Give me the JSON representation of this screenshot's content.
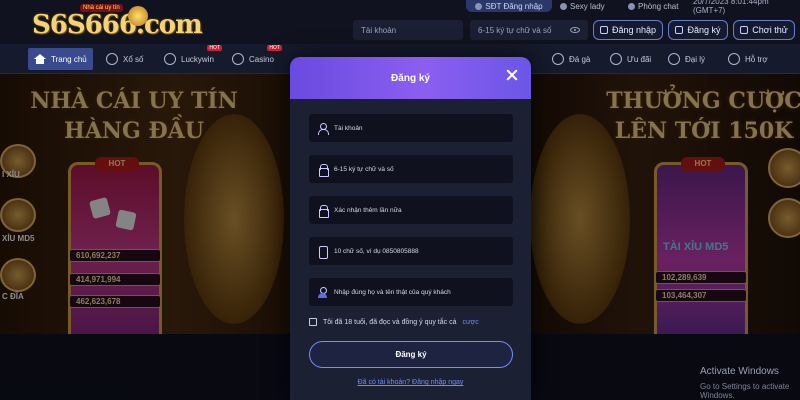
{
  "brand": {
    "logo_text": "S6S666.com",
    "logo_tag": "Nhà cái uy tín"
  },
  "topbar": {
    "sdt_label": "SĐT Đăng nhập",
    "sexy_label": "Sexy lady",
    "phong_label": "Phòng chat",
    "datetime": "20/7/2023 8:01:44pm (GMT+7)",
    "username_placeholder": "Tài khoản",
    "password_placeholder": "6-15 ký tự chữ và số",
    "login_label": "Đăng nhập",
    "register_label": "Đăng ký",
    "try_label": "Chơi thử"
  },
  "nav": {
    "items": [
      {
        "label": "Trang chủ"
      },
      {
        "label": "Xổ số"
      },
      {
        "label": "Luckywin"
      },
      {
        "label": "Casino"
      },
      {
        "label": "Đá gà"
      },
      {
        "label": "Ưu đãi"
      },
      {
        "label": "Đại lý"
      },
      {
        "label": "Hỗ trợ"
      }
    ]
  },
  "banner": {
    "left_title": "NHÀ CÁI UY TÍN HÀNG ĐẦU",
    "right_title": "THƯỞNG CƯỢC LÊN TỚI 150K",
    "left_card": {
      "hot": "HOT",
      "value1": "610,692,237",
      "value2": "414,971,994",
      "value3": "462,623,678"
    },
    "right_card": {
      "hot": "HOT",
      "title": "TÀI XỈU MD5",
      "value1": "102,289,639",
      "value2": "103,464,307"
    },
    "side_labels": [
      "I XỈU",
      "XỈU MD5",
      "C ĐĨA"
    ]
  },
  "modal": {
    "title": "Đăng ký",
    "fields": [
      {
        "placeholder": "Tài khoản",
        "icon": "user-icon"
      },
      {
        "placeholder": "6-15 ký tự chữ và số",
        "icon": "lock-icon"
      },
      {
        "placeholder": "Xác nhận thêm lần nữa",
        "icon": "lock-icon"
      },
      {
        "placeholder": "10 chữ số, ví dụ 0850805888",
        "icon": "phone-icon"
      },
      {
        "placeholder": "Nhập đúng họ và tên thật của quý khách",
        "icon": "person-icon"
      }
    ],
    "terms_text": "Tôi đã 18 tuổi, đã đọc và đồng ý quy tắc cá",
    "terms_link": "cược",
    "submit_label": "Đăng ký",
    "login_link": "Đã có tài khoản? Đăng nhập ngay"
  },
  "watermark": {
    "title": "Activate Windows",
    "subtitle": "Go to Settings to activate Windows."
  },
  "colors": {
    "accent": "#7a5cf0",
    "link": "#6f8cff",
    "gold": "#f0d28c"
  }
}
